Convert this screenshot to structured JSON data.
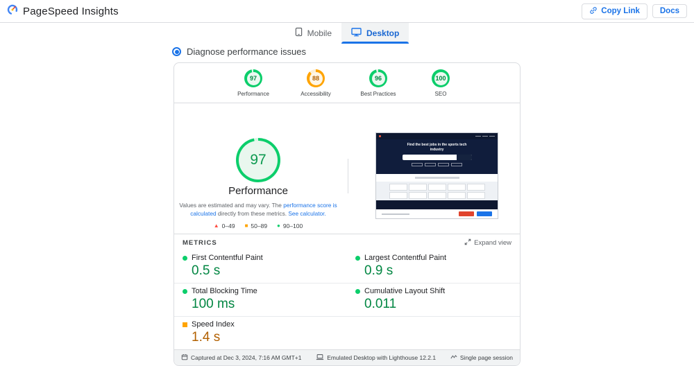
{
  "header": {
    "title": "PageSpeed Insights",
    "copy_link_label": "Copy Link",
    "docs_label": "Docs"
  },
  "tabs": {
    "mobile": "Mobile",
    "desktop": "Desktop"
  },
  "diagnose_label": "Diagnose performance issues",
  "categories": [
    {
      "label": "Performance",
      "score": "97",
      "level": "good"
    },
    {
      "label": "Accessibility",
      "score": "88",
      "level": "average"
    },
    {
      "label": "Best Practices",
      "score": "96",
      "level": "good"
    },
    {
      "label": "SEO",
      "score": "100",
      "level": "good"
    }
  ],
  "gauge": {
    "score": "97",
    "label": "Performance"
  },
  "disclaimer": {
    "text1": "Values are estimated and may vary. The ",
    "link1": "performance score is calculated",
    "text2": " directly from these metrics. ",
    "link2": "See calculator."
  },
  "legend": {
    "poor": "0–49",
    "average": "50–89",
    "good": "90–100"
  },
  "thumbnail": {
    "heading": "Find the best jobs in the sports tech industry"
  },
  "metrics_header": {
    "title": "METRICS",
    "expand_label": "Expand view"
  },
  "metrics": [
    {
      "name": "First Contentful Paint",
      "value": "0.5 s",
      "level": "good"
    },
    {
      "name": "Largest Contentful Paint",
      "value": "0.9 s",
      "level": "good"
    },
    {
      "name": "Total Blocking Time",
      "value": "100 ms",
      "level": "good"
    },
    {
      "name": "Cumulative Layout Shift",
      "value": "0.011",
      "level": "good"
    },
    {
      "name": "Speed Index",
      "value": "1.4 s",
      "level": "average"
    }
  ],
  "footer": {
    "captured": "Captured at Dec 3, 2024, 7:16 AM GMT+1",
    "environment": "Emulated Desktop with Lighthouse 12.2.1",
    "session": "Single page session"
  },
  "colors": {
    "good": "#0cce6b",
    "good_text": "#018642",
    "average": "#ffa400",
    "average_text": "#b26000",
    "poor": "#ff4e42",
    "accent": "#1a73e8"
  }
}
